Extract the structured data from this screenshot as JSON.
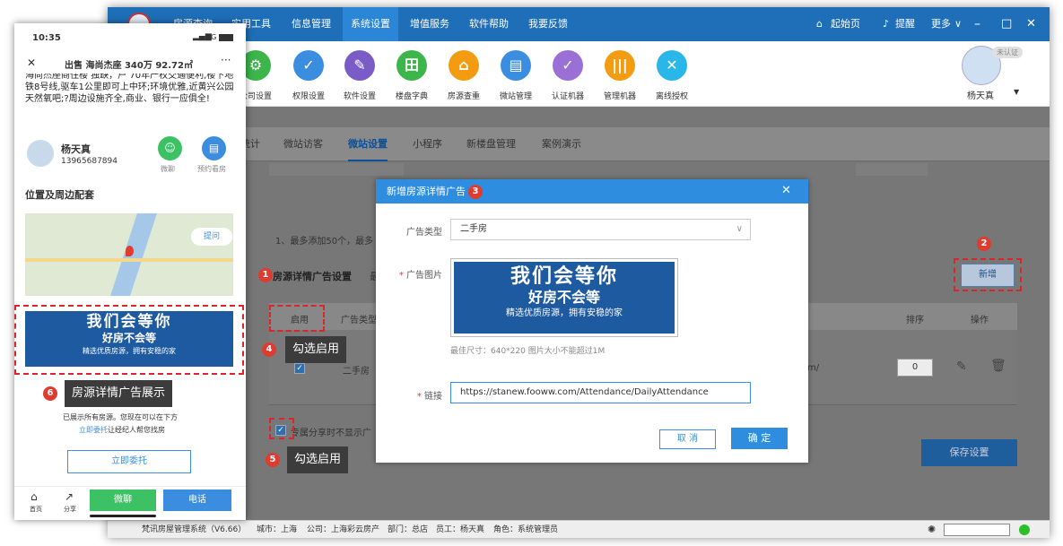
{
  "window": {
    "nav_tabs": [
      "房源查询",
      "实用工具",
      "信息管理",
      "系统设置",
      "增值服务",
      "软件帮助",
      "我要反馈"
    ],
    "active_tab": "系统设置",
    "right_items": {
      "home": "起始页",
      "remind": "提醒",
      "more": "更多"
    },
    "toolbar": [
      "公司设置",
      "权限设置",
      "软件设置",
      "楼盘字典",
      "房源查重",
      "微站管理",
      "认证机器",
      "管理机器",
      "离线授权"
    ],
    "user": {
      "name": "杨天真",
      "badge": "未认证"
    },
    "sub_tabs": [
      "统计",
      "微站访客",
      "微站设置",
      "小程序",
      "新楼盘管理",
      "案例演示"
    ],
    "active_sub_tab": "微站设置",
    "hint": "1、最多添加50个，最多",
    "section_title": "房源详情广告设置",
    "section_extra": "最",
    "add_button": "新增",
    "table_headers": {
      "enable": "启用",
      "type": "广告类型",
      "order": "排序",
      "action": "操作"
    },
    "row": {
      "type": "二手房",
      "link_tail": "m/",
      "order": "0"
    },
    "share_option": "专属分享时不显示广",
    "save_button": "保存设置",
    "status": {
      "version": "梵讯房屋管理系统（V6.66）",
      "city": "城市：上海",
      "company": "公司：上海彩云房产",
      "dept": "部门：总店",
      "staff": "员工：杨天真",
      "role": "角色：系统管理员"
    }
  },
  "dialog": {
    "title": "新增房源详情广告",
    "type_label": "广告类型",
    "type_value": "二手房",
    "image_label": "广告图片",
    "image_hint": "最佳尺寸：640*220 图片大小不能超过1M",
    "link_label": "链接",
    "link_value": "https://stanew.fooww.com/Attendance/DailyAttendance",
    "cancel": "取 消",
    "confirm": "确 定"
  },
  "banner": {
    "line1": "我们会等你",
    "line2": "好房不会等",
    "line3": "精选优质房源，拥有安稳的家"
  },
  "phone": {
    "time": "10:35",
    "signal": "4G",
    "title": "出售 海尚杰座 340万 92.72㎡",
    "desc": "海尚杰座商住楼 独缺，户 70年产权交通便利,楼下地铁8号线,驱车1公里即可上中环;环境优雅,近黄兴公园天然氧吧;?周边设施齐全,商业、银行一应俱全!",
    "agent_name": "杨天真",
    "agent_phone": "13965687894",
    "wechat_btn": "微聊",
    "visit_btn": "预约看房",
    "section": "位置及周边配套",
    "map_btn": "提问",
    "footer_text": "已展示所有房源。您现在可以在下方",
    "footer_link": "立即委托",
    "footer_text2": "让经纪人帮您找房",
    "entrust": "立即委托",
    "bottom": {
      "home": "首页",
      "share": "分享",
      "chat": "微聊",
      "call": "电话"
    }
  },
  "annotations": {
    "c1": "1",
    "c2": "2",
    "c3": "3",
    "c4": "4",
    "c5": "5",
    "c6": "6",
    "tip4": "勾选启用",
    "tip5": "勾选启用",
    "tip6": "房源详情广告展示"
  },
  "colors": {
    "primary": "#1f6fb8",
    "dialog_header": "#2f8de0",
    "annot_red": "#e03b2f",
    "chat_green": "#3cc264"
  }
}
